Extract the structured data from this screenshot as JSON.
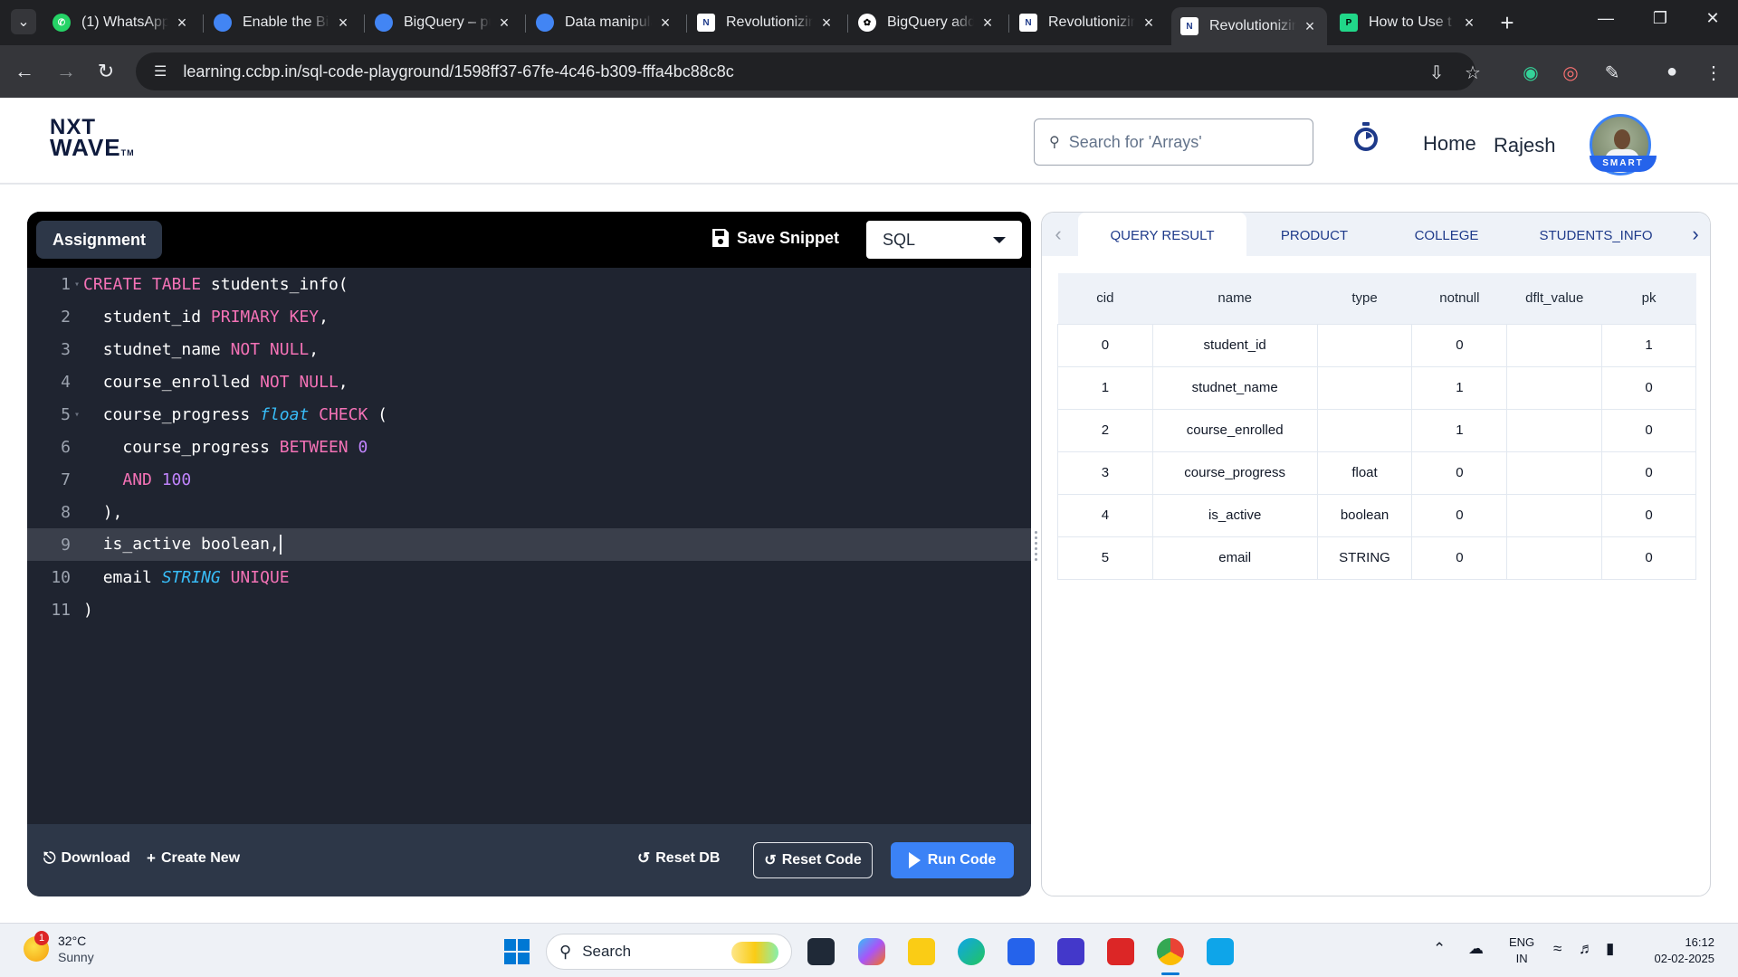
{
  "browser": {
    "tabs": [
      {
        "title": "(1) WhatsApp",
        "icon": "whatsapp-icon",
        "color": "#25d366"
      },
      {
        "title": "Enable the BigQuery",
        "icon": "google-cloud-icon",
        "color": "#4285f4"
      },
      {
        "title": "BigQuery – public",
        "icon": "bigquery-icon",
        "color": "#4285f4"
      },
      {
        "title": "Data manipulation",
        "icon": "google-cloud-icon",
        "color": "#4285f4"
      },
      {
        "title": "Revolutionizing",
        "icon": "nxtwave-icon",
        "color": "#1e3a8a"
      },
      {
        "title": "BigQuery add",
        "icon": "chatgpt-icon",
        "color": "#ffffff"
      },
      {
        "title": "Revolutionizing",
        "icon": "nxtwave-icon",
        "color": "#1e3a8a"
      },
      {
        "title": "Revolutionizing",
        "icon": "nxtwave-icon",
        "color": "#1e3a8a"
      },
      {
        "title": "How to Use t",
        "icon": "pycharm-icon",
        "color": "#21d789"
      }
    ],
    "active_tab_index": 7,
    "url": "learning.ccbp.in/sql-code-playground/1598ff37-67fe-4c46-b309-fffa4bc88c8c"
  },
  "header": {
    "logo_line1": "NXT",
    "logo_line2": "WAVE",
    "logo_tm": "TM",
    "search_placeholder": "Search for 'Arrays'",
    "nav_home": "Home",
    "user_name": "Rajesh",
    "avatar_badge": "SMART"
  },
  "editor": {
    "assignment_label": "Assignment",
    "save_snippet_label": "Save Snippet",
    "language": "SQL",
    "active_line": 9,
    "lines": [
      {
        "n": "1",
        "fold": true
      },
      {
        "n": "2",
        "fold": false
      },
      {
        "n": "3",
        "fold": false
      },
      {
        "n": "4",
        "fold": false
      },
      {
        "n": "5",
        "fold": true
      },
      {
        "n": "6",
        "fold": false
      },
      {
        "n": "7",
        "fold": false
      },
      {
        "n": "8",
        "fold": false
      },
      {
        "n": "9",
        "fold": false
      },
      {
        "n": "10",
        "fold": false
      },
      {
        "n": "11",
        "fold": false
      }
    ],
    "code_tokens": {
      "l1": [
        "CREATE",
        "TABLE",
        "students_info("
      ],
      "l2": [
        "student_id",
        "PRIMARY KEY",
        ","
      ],
      "l3": [
        "studnet_name",
        "NOT NULL",
        ","
      ],
      "l4": [
        "course_enrolled",
        "NOT NULL",
        ","
      ],
      "l5": [
        "course_progress",
        "float",
        "CHECK",
        "("
      ],
      "l6": [
        "course_progress",
        "BETWEEN",
        "0"
      ],
      "l7": [
        "AND",
        "100"
      ],
      "l8": [
        "),"
      ],
      "l9": [
        "is_active boolean,"
      ],
      "l10": [
        "email",
        "STRING",
        "UNIQUE"
      ],
      "l11": [
        ")"
      ]
    },
    "download_label": "Download",
    "create_new_label": "Create New",
    "reset_db_label": "Reset DB",
    "reset_code_label": "Reset Code",
    "run_code_label": "Run Code"
  },
  "results": {
    "tabs": [
      "QUERY RESULT",
      "PRODUCT",
      "COLLEGE",
      "STUDENTS_INFO"
    ],
    "active_tab": 0,
    "columns": [
      "cid",
      "name",
      "type",
      "notnull",
      "dflt_value",
      "pk"
    ],
    "rows": [
      [
        "0",
        "student_id",
        "",
        "0",
        "",
        "1"
      ],
      [
        "1",
        "studnet_name",
        "",
        "1",
        "",
        "0"
      ],
      [
        "2",
        "course_enrolled",
        "",
        "1",
        "",
        "0"
      ],
      [
        "3",
        "course_progress",
        "float",
        "0",
        "",
        "0"
      ],
      [
        "4",
        "is_active",
        "boolean",
        "0",
        "",
        "0"
      ],
      [
        "5",
        "email",
        "STRING",
        "0",
        "",
        "0"
      ]
    ]
  },
  "taskbar": {
    "temperature": "32°C",
    "condition": "Sunny",
    "weather_badge": "1",
    "search_label": "Search",
    "lang_line1": "ENG",
    "lang_line2": "IN",
    "time": "16:12",
    "date": "02-02-2025"
  },
  "colors": {
    "keyword": "#f472b6",
    "type": "#38bdf8",
    "number": "#c084fc",
    "accent_blue": "#3b82f6",
    "editor_bg": "#1f2430"
  }
}
